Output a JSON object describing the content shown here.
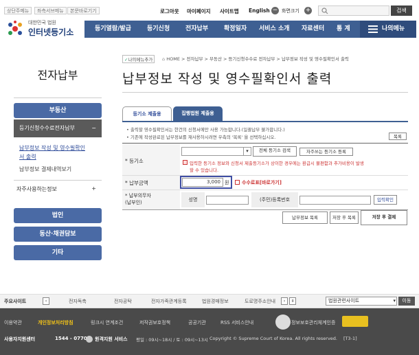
{
  "top": {
    "skip_links": [
      "상단주메뉴",
      "좌측서브메뉴",
      "본문바로기기"
    ],
    "links": [
      "로그아웃",
      "마이페이지",
      "사이트맵",
      "English"
    ],
    "font_label": "화면크기",
    "search_button": "검색"
  },
  "logo": {
    "line1": "대한민국 법원",
    "line2": "인터넷등기소"
  },
  "nav": {
    "items": [
      "등기열람/발급",
      "등기신청",
      "전자납부",
      "확정일자",
      "서비스 소개",
      "자료센터",
      "통 계"
    ],
    "my_menu": "나의메뉴"
  },
  "sidebar": {
    "title": "전자납부",
    "real_estate": "부동산",
    "section": "등기신청수수료전자납부",
    "section_toggle": "−",
    "sub1a": "납부정보 작성 및 영수필확인",
    "sub1b": "서 출력",
    "sub2": "납부정보 결제내역보기",
    "frequent": "자주사용하는정보",
    "frequent_toggle": "+",
    "btn_corp": "법인",
    "btn_movable": "동산·채권담보",
    "btn_etc": "기타"
  },
  "breadcrumb": {
    "my_menu_add": "나의메뉴추가",
    "path": "HOME > 전자납부 > 부동산 > 등기신청수수료 전자납부 > 납부정보 작성 및 영수필확인서 출력"
  },
  "page": {
    "title": "납부정보 작성 및 영수필확인서 출력"
  },
  "tabs": {
    "registry": "등기소 제출용",
    "court": "집행법원 제출용"
  },
  "notes": {
    "n1": "• 출력할 영수필확인서는 한건의 신청서에만 사용 가능합니다.(일괄납부 불가합니다.)",
    "n2": "• 기존에 작성완료된 납부정보를 재사용하시려면 우측의 '목록' 을 선택하십시오.",
    "list_btn": "목록"
  },
  "form": {
    "registry_label": "* 등기소",
    "registry_search": "전체 등기소 검색",
    "frequent_registry": "자주쓰는 등기소 등록",
    "warning1": "입력한 등기소 정보와 신청서 제출등기소가 상이한 경우에는 환급시 불편함과 추가비용이 발생",
    "warning2": "할 수 있습니다.",
    "amount_label": "* 납부금액",
    "amount_value": "3,000",
    "amount_unit": "원",
    "fee_table": "수수료표[바로가기]",
    "payer_label1": "* 납부의무자",
    "payer_label2": "(납부인)",
    "name_label": "성명",
    "id_label": "(주민)등록번호",
    "id_check": "입력확인"
  },
  "buttons": {
    "list": "납부정보 목록",
    "save_list": "저장 후 목록",
    "save_pay": "저장 후 결제"
  },
  "footer": {
    "sites_label": "주요사이트",
    "sites": [
      "전자독촉",
      "전자공탁",
      "전자가족관계등록",
      "법원경매정보",
      "도로명주소안내"
    ],
    "select": "법원관련사이트",
    "go": "이동",
    "links": [
      "이용약관",
      "개인정보처리방침",
      "링크시 연계조건",
      "저작권보호정책",
      "공공기관",
      "RSS 서비스안내"
    ],
    "cert": "정보보호관리체계인증",
    "contact_label": "사용자지원센터",
    "phone": "1544 - 0770",
    "remote": "원격지원 서비스",
    "hours": "평일 : 09시~18시 / 토 : 09시~13시",
    "copyright": "Copyright © Supreme Court of Korea. All rights reserved.",
    "code": "[T3-1]"
  },
  "colors": {
    "nav": "#3e5f92",
    "sidebar": "#4a6aa5",
    "highlight": "#3f4ea3",
    "footer": "#4a4a4a"
  }
}
